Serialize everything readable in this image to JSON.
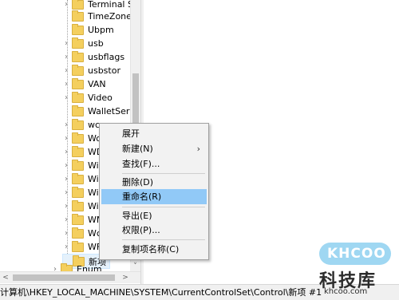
{
  "tree": {
    "items": [
      {
        "label": "Terminal Se",
        "chevron": "›"
      },
      {
        "label": "TimeZoneIr",
        "chevron": ""
      },
      {
        "label": "Ubpm",
        "chevron": ""
      },
      {
        "label": "usb",
        "chevron": "›"
      },
      {
        "label": "usbflags",
        "chevron": "›"
      },
      {
        "label": "usbstor",
        "chevron": "›"
      },
      {
        "label": "VAN",
        "chevron": "›"
      },
      {
        "label": "Video",
        "chevron": "›"
      },
      {
        "label": "WalletServi",
        "chevron": ""
      },
      {
        "label": "wcncsvc",
        "chevron": "›"
      },
      {
        "label": "Wo",
        "chevron": "›"
      },
      {
        "label": "WD",
        "chevron": "›"
      },
      {
        "label": "Wi",
        "chevron": "›"
      },
      {
        "label": "Wi",
        "chevron": "›"
      },
      {
        "label": "Wi",
        "chevron": "›"
      },
      {
        "label": "Wi",
        "chevron": "›"
      },
      {
        "label": "WM",
        "chevron": "›"
      },
      {
        "label": "Wc",
        "chevron": "›"
      },
      {
        "label": "WF",
        "chevron": "›"
      },
      {
        "label": "新项",
        "chevron": ""
      }
    ],
    "enum_item": {
      "label": "Enum",
      "chevron": "›"
    }
  },
  "context_menu": {
    "items": [
      {
        "label": "展开",
        "has_submenu": false
      },
      {
        "label": "新建(N)",
        "has_submenu": true
      },
      {
        "label": "查找(F)...",
        "has_submenu": false
      },
      {
        "label": "删除(D)",
        "has_submenu": false
      },
      {
        "label": "重命名(R)",
        "has_submenu": false,
        "highlighted": true
      },
      {
        "label": "导出(E)",
        "has_submenu": false
      },
      {
        "label": "权限(P)...",
        "has_submenu": false
      },
      {
        "label": "复制项名称(C)",
        "has_submenu": false
      }
    ],
    "submenu_arrow": "›"
  },
  "statusbar": {
    "path": "计算机\\HKEY_LOCAL_MACHINE\\SYSTEM\\CurrentControlSet\\Control\\新项 #1"
  },
  "scroll": {
    "down_arrow": "˅",
    "left_arrow": "<",
    "right_arrow": ">"
  },
  "watermark": {
    "badge": "KHCOO",
    "brand": "科技库",
    "url": "khcoo.com"
  },
  "colors": {
    "folder": "#f4cf5e",
    "highlight": "#91c9f7",
    "menu_bg": "#f2f2f2"
  }
}
